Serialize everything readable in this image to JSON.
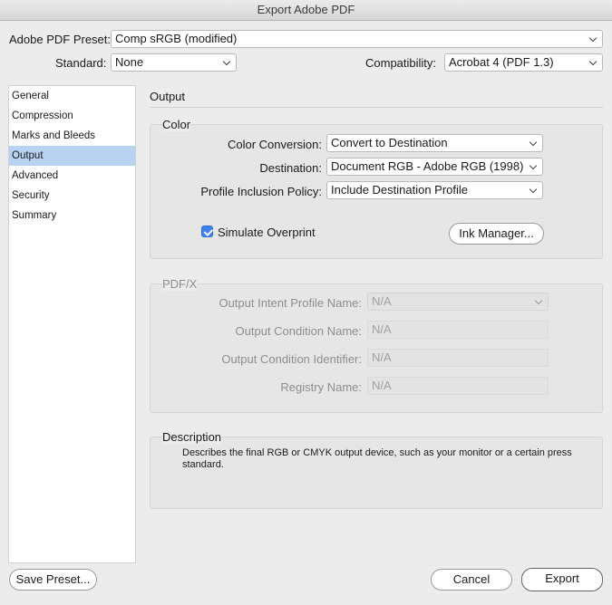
{
  "window": {
    "title": "Export Adobe PDF"
  },
  "header": {
    "preset_label": "Adobe PDF Preset:",
    "preset_value": "Comp sRGB (modified)",
    "standard_label": "Standard:",
    "standard_value": "None",
    "compat_label": "Compatibility:",
    "compat_value": "Acrobat 4 (PDF 1.3)"
  },
  "sidebar": {
    "items": [
      {
        "label": "General"
      },
      {
        "label": "Compression"
      },
      {
        "label": "Marks and Bleeds"
      },
      {
        "label": "Output"
      },
      {
        "label": "Advanced"
      },
      {
        "label": "Security"
      },
      {
        "label": "Summary"
      }
    ],
    "selected": "Output"
  },
  "main": {
    "section_title": "Output",
    "color": {
      "title": "Color",
      "conversion_label": "Color Conversion:",
      "conversion_value": "Convert to Destination",
      "destination_label": "Destination:",
      "destination_value": "Document RGB - Adobe RGB (1998)",
      "policy_label": "Profile Inclusion Policy:",
      "policy_value": "Include Destination Profile",
      "simulate_label": "Simulate Overprint",
      "simulate_checked": true,
      "ink_manager_label": "Ink Manager..."
    },
    "pdfx": {
      "title": "PDF/X",
      "intent_label": "Output Intent Profile Name:",
      "intent_value": "N/A",
      "condition_name_label": "Output Condition Name:",
      "condition_name_value": "N/A",
      "condition_id_label": "Output Condition Identifier:",
      "condition_id_value": "N/A",
      "registry_label": "Registry Name:",
      "registry_value": "N/A"
    },
    "description": {
      "title": "Description",
      "text": "Describes the final RGB or CMYK output device, such as your monitor or a certain press standard."
    }
  },
  "footer": {
    "save_preset_label": "Save Preset...",
    "cancel_label": "Cancel",
    "export_label": "Export"
  }
}
